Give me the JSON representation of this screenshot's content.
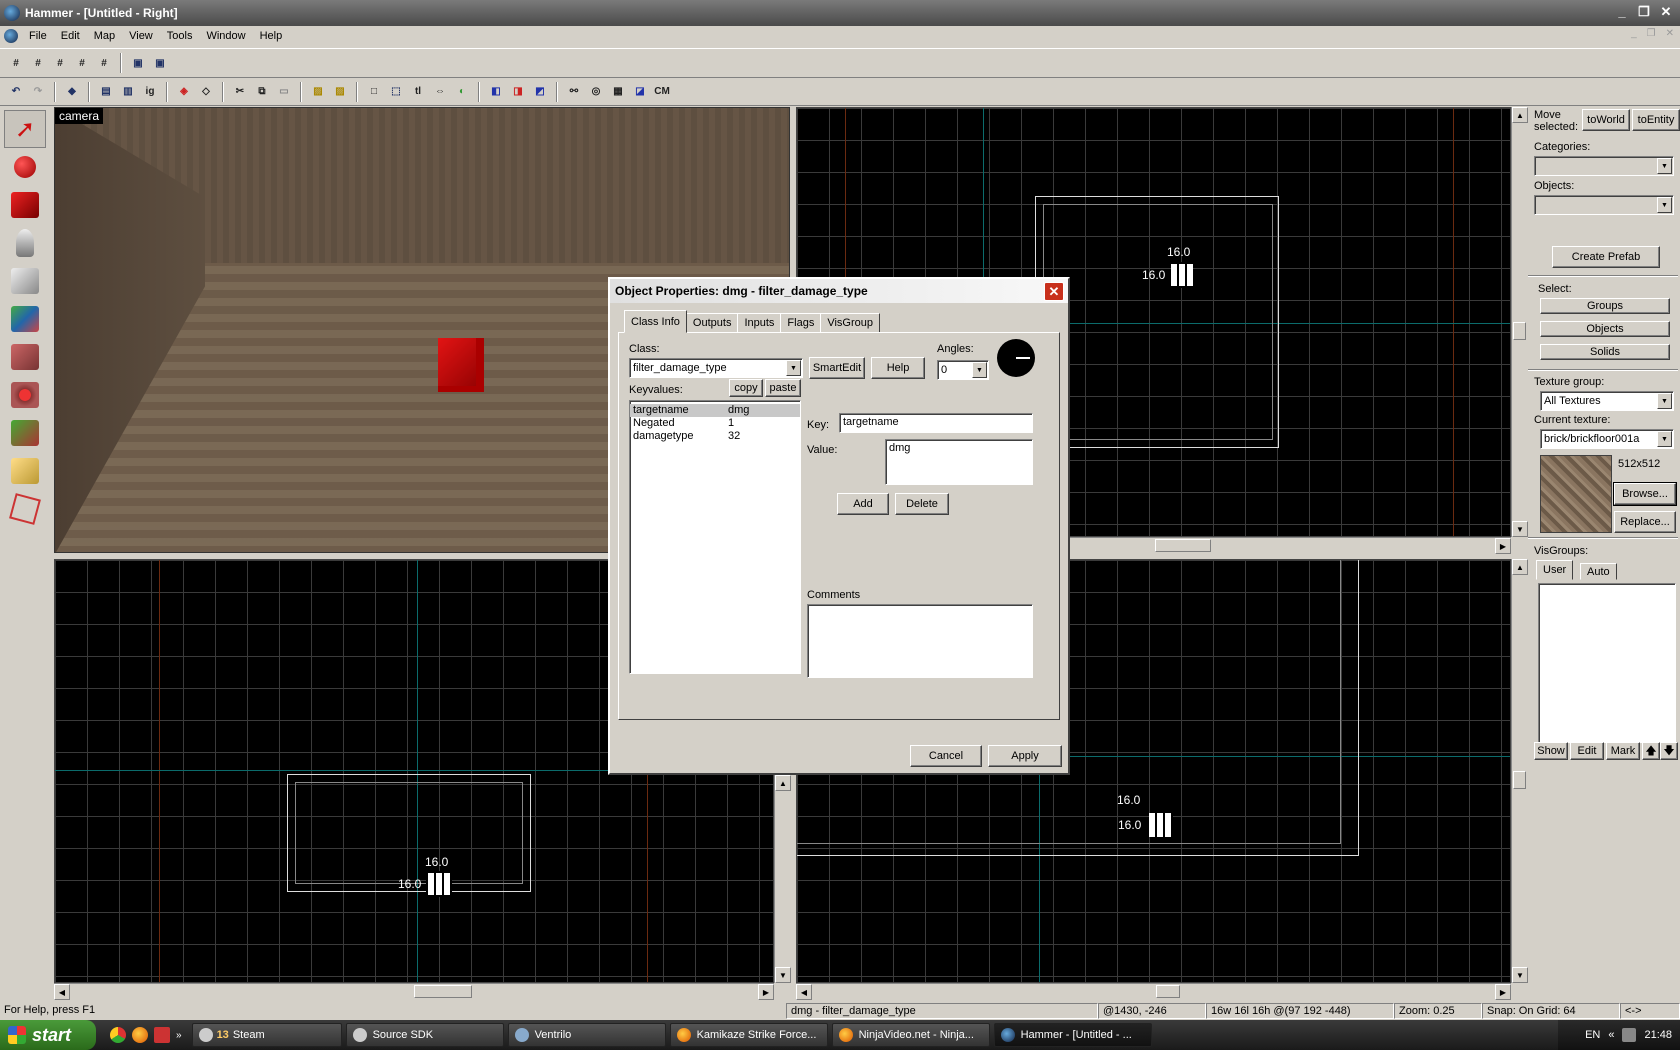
{
  "window": {
    "title": "Hammer - [Untitled - Right]"
  },
  "menu": [
    "File",
    "Edit",
    "Map",
    "View",
    "Tools",
    "Window",
    "Help"
  ],
  "toolbar2": {
    "ig_label": "ig",
    "tl_label": "tl",
    "cm_label": "CM"
  },
  "camera": {
    "label": "camera"
  },
  "viewports": {
    "top_right": {
      "w": "16.0",
      "h": "16.0"
    },
    "bottom_left": {
      "w": "16.0",
      "h": "16.0"
    },
    "bottom_right": {
      "w": "16.0",
      "h": "16.0"
    }
  },
  "right_panel": {
    "move_selected": "Move selected:",
    "to_world": "toWorld",
    "to_entity": "toEntity",
    "categories": "Categories:",
    "objects_label": "Objects:",
    "create_prefab": "Create Prefab",
    "select": "Select:",
    "groups": "Groups",
    "objects": "Objects",
    "solids": "Solids",
    "texture_group_label": "Texture group:",
    "texture_group_value": "All Textures",
    "current_texture_label": "Current texture:",
    "current_texture_value": "brick/brickfloor001a",
    "texture_size": "512x512",
    "browse": "Browse...",
    "replace": "Replace...",
    "visgroups": "VisGroups:",
    "tab_user": "User",
    "tab_auto": "Auto",
    "show": "Show",
    "edit": "Edit",
    "mark": "Mark",
    "up_arrow": "🡅",
    "down_arrow": "🡇"
  },
  "dialog": {
    "title": "Object Properties: dmg - filter_damage_type",
    "close": "✕",
    "tabs": [
      "Class Info",
      "Outputs",
      "Inputs",
      "Flags",
      "VisGroup"
    ],
    "class_label": "Class:",
    "class_value": "filter_damage_type",
    "smartedit": "SmartEdit",
    "help": "Help",
    "angles_label": "Angles:",
    "angles_value": "0",
    "keyvalues_label": "Keyvalues:",
    "copy": "copy",
    "paste": "paste",
    "keyvalues": [
      {
        "key": "targetname",
        "value": "dmg"
      },
      {
        "key": "Negated",
        "value": "1"
      },
      {
        "key": "damagetype",
        "value": "32"
      }
    ],
    "key_label": "Key:",
    "key_value": "targetname",
    "value_label": "Value:",
    "value_value": "dmg",
    "add": "Add",
    "delete": "Delete",
    "comments_label": "Comments",
    "cancel": "Cancel",
    "apply": "Apply"
  },
  "status": {
    "help": "For Help, press F1",
    "selection": "dmg - filter_damage_type",
    "coords": "@1430, -246",
    "size": "16w 16l 16h @(97 192 -448)",
    "zoom": "Zoom: 0.25",
    "snap": "Snap: On Grid: 64",
    "arrows": "<->"
  },
  "taskbar": {
    "start": "start",
    "steam_count": "13",
    "tasks": [
      "Steam",
      "Source SDK",
      "Ventrilo",
      "Kamikaze Strike Force...",
      "NinjaVideo.net - Ninja...",
      "Hammer - [Untitled - ..."
    ],
    "lang": "EN",
    "clock": "21:48"
  }
}
